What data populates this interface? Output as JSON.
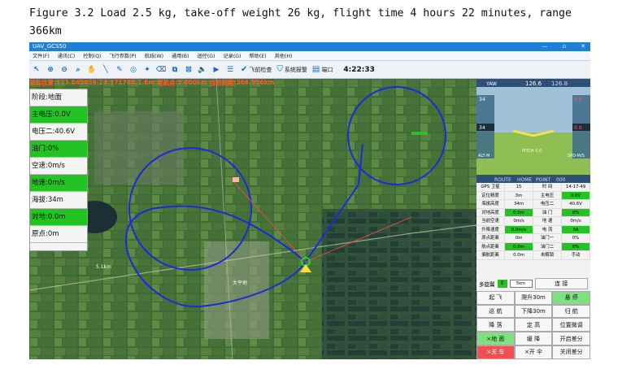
{
  "caption": {
    "line1": "Figure 3.2 Load 2.5 kg, take-off weight 26 kg, flight time 4 hours 22 minutes, range",
    "line2": "366km"
  },
  "window": {
    "title": "UAV_GCS50",
    "min": "—",
    "max": "▫",
    "close": "✕"
  },
  "menu": [
    "文件(F)",
    "通讯(C)",
    "控制(Q)",
    "飞行参数(P)",
    "航线(W)",
    "通用(B)",
    "遥控(G)",
    "记录(G)",
    "帮助(E)",
    "其他(H)"
  ],
  "toolbar": {
    "preflight": "飞前检查",
    "alarm": "系统报警",
    "port": "端口",
    "time": "4:22:33"
  },
  "map": {
    "coords": "鼠标位置:113.845439,23.171788,1.6m 距航点:2.000km 当前航距:366.956km",
    "label_home": "大平地",
    "label_dist": "5.1km",
    "colors": {
      "track": "#1a2bd8",
      "route": "#ff4a4a",
      "uav": "#2ad02a"
    }
  },
  "left_panel": [
    {
      "label": "阶段:地面",
      "green": false
    },
    {
      "label": "主电压:0.0V",
      "green": true
    },
    {
      "label": "电压二:40.6V",
      "green": false
    },
    {
      "label": "油门:0%",
      "green": true
    },
    {
      "label": "空速:0m/s",
      "green": false
    },
    {
      "label": "地速:0m/s",
      "green": true
    },
    {
      "label": "海拔:34m",
      "green": false
    },
    {
      "label": "对地:0.0m",
      "green": true
    },
    {
      "label": "原点:0m",
      "green": false
    }
  ],
  "hud": {
    "yaw": "YAW",
    "heading": "126.6",
    "heading2": "126.8",
    "left_top": "34",
    "left_mid": "34",
    "right_top": "0.0",
    "right_mid": "0.0",
    "alt": "ALT·M",
    "spd": "SPD·M/S",
    "pitch": "PITCH 0.0",
    "tabs": [
      "ROUTE",
      "HOME",
      "POINT"
    ],
    "point_val": "000"
  },
  "grid": [
    [
      "GPS 卫星",
      "15",
      "时  间",
      "14-17-49"
    ],
    [
      "定位精度",
      "3m",
      "主电压",
      "0.0V"
    ],
    [
      "海拔高度",
      "34m",
      "电压二",
      "40.6V"
    ],
    [
      "对地高度",
      "0.0m",
      "油  门",
      "0%"
    ],
    [
      "当前空速",
      "0m/s",
      "地  速",
      "0m/s"
    ],
    [
      "升降速度",
      "0.0m/s",
      "电  流",
      "0A"
    ],
    [
      "原点距离",
      "0m",
      "油门一",
      "0%"
    ],
    [
      "航点距离",
      "0.0m",
      "油门二",
      "0%"
    ],
    [
      "偏航距离",
      "0.0m",
      "未解锁",
      "手动"
    ]
  ],
  "grid_green": [
    [
      1,
      3
    ],
    [
      3,
      1
    ],
    [
      3,
      3
    ],
    [
      5,
      1
    ],
    [
      5,
      3
    ],
    [
      7,
      1
    ],
    [
      7,
      3
    ]
  ],
  "commands": {
    "multi": "多旋翼",
    "multi_val": "0",
    "unit": "5km",
    "connect": "连  接",
    "rows": [
      [
        {
          "t": "起  飞",
          "c": ""
        },
        {
          "t": "爬升30m",
          "c": ""
        },
        {
          "t": "悬  停",
          "c": "green"
        }
      ],
      [
        {
          "t": "巡  航",
          "c": ""
        },
        {
          "t": "下降30m",
          "c": ""
        },
        {
          "t": "归  航",
          "c": ""
        }
      ],
      [
        {
          "t": "降  落",
          "c": ""
        },
        {
          "t": "定  高",
          "c": ""
        },
        {
          "t": "位置微调",
          "c": ""
        }
      ],
      [
        {
          "t": "×地  面",
          "c": "green"
        },
        {
          "t": "缓  降",
          "c": ""
        },
        {
          "t": "开启差分",
          "c": ""
        }
      ],
      [
        {
          "t": "×关  车",
          "c": "red"
        },
        {
          "t": "×开  伞",
          "c": ""
        },
        {
          "t": "关闭差分",
          "c": ""
        }
      ]
    ]
  }
}
